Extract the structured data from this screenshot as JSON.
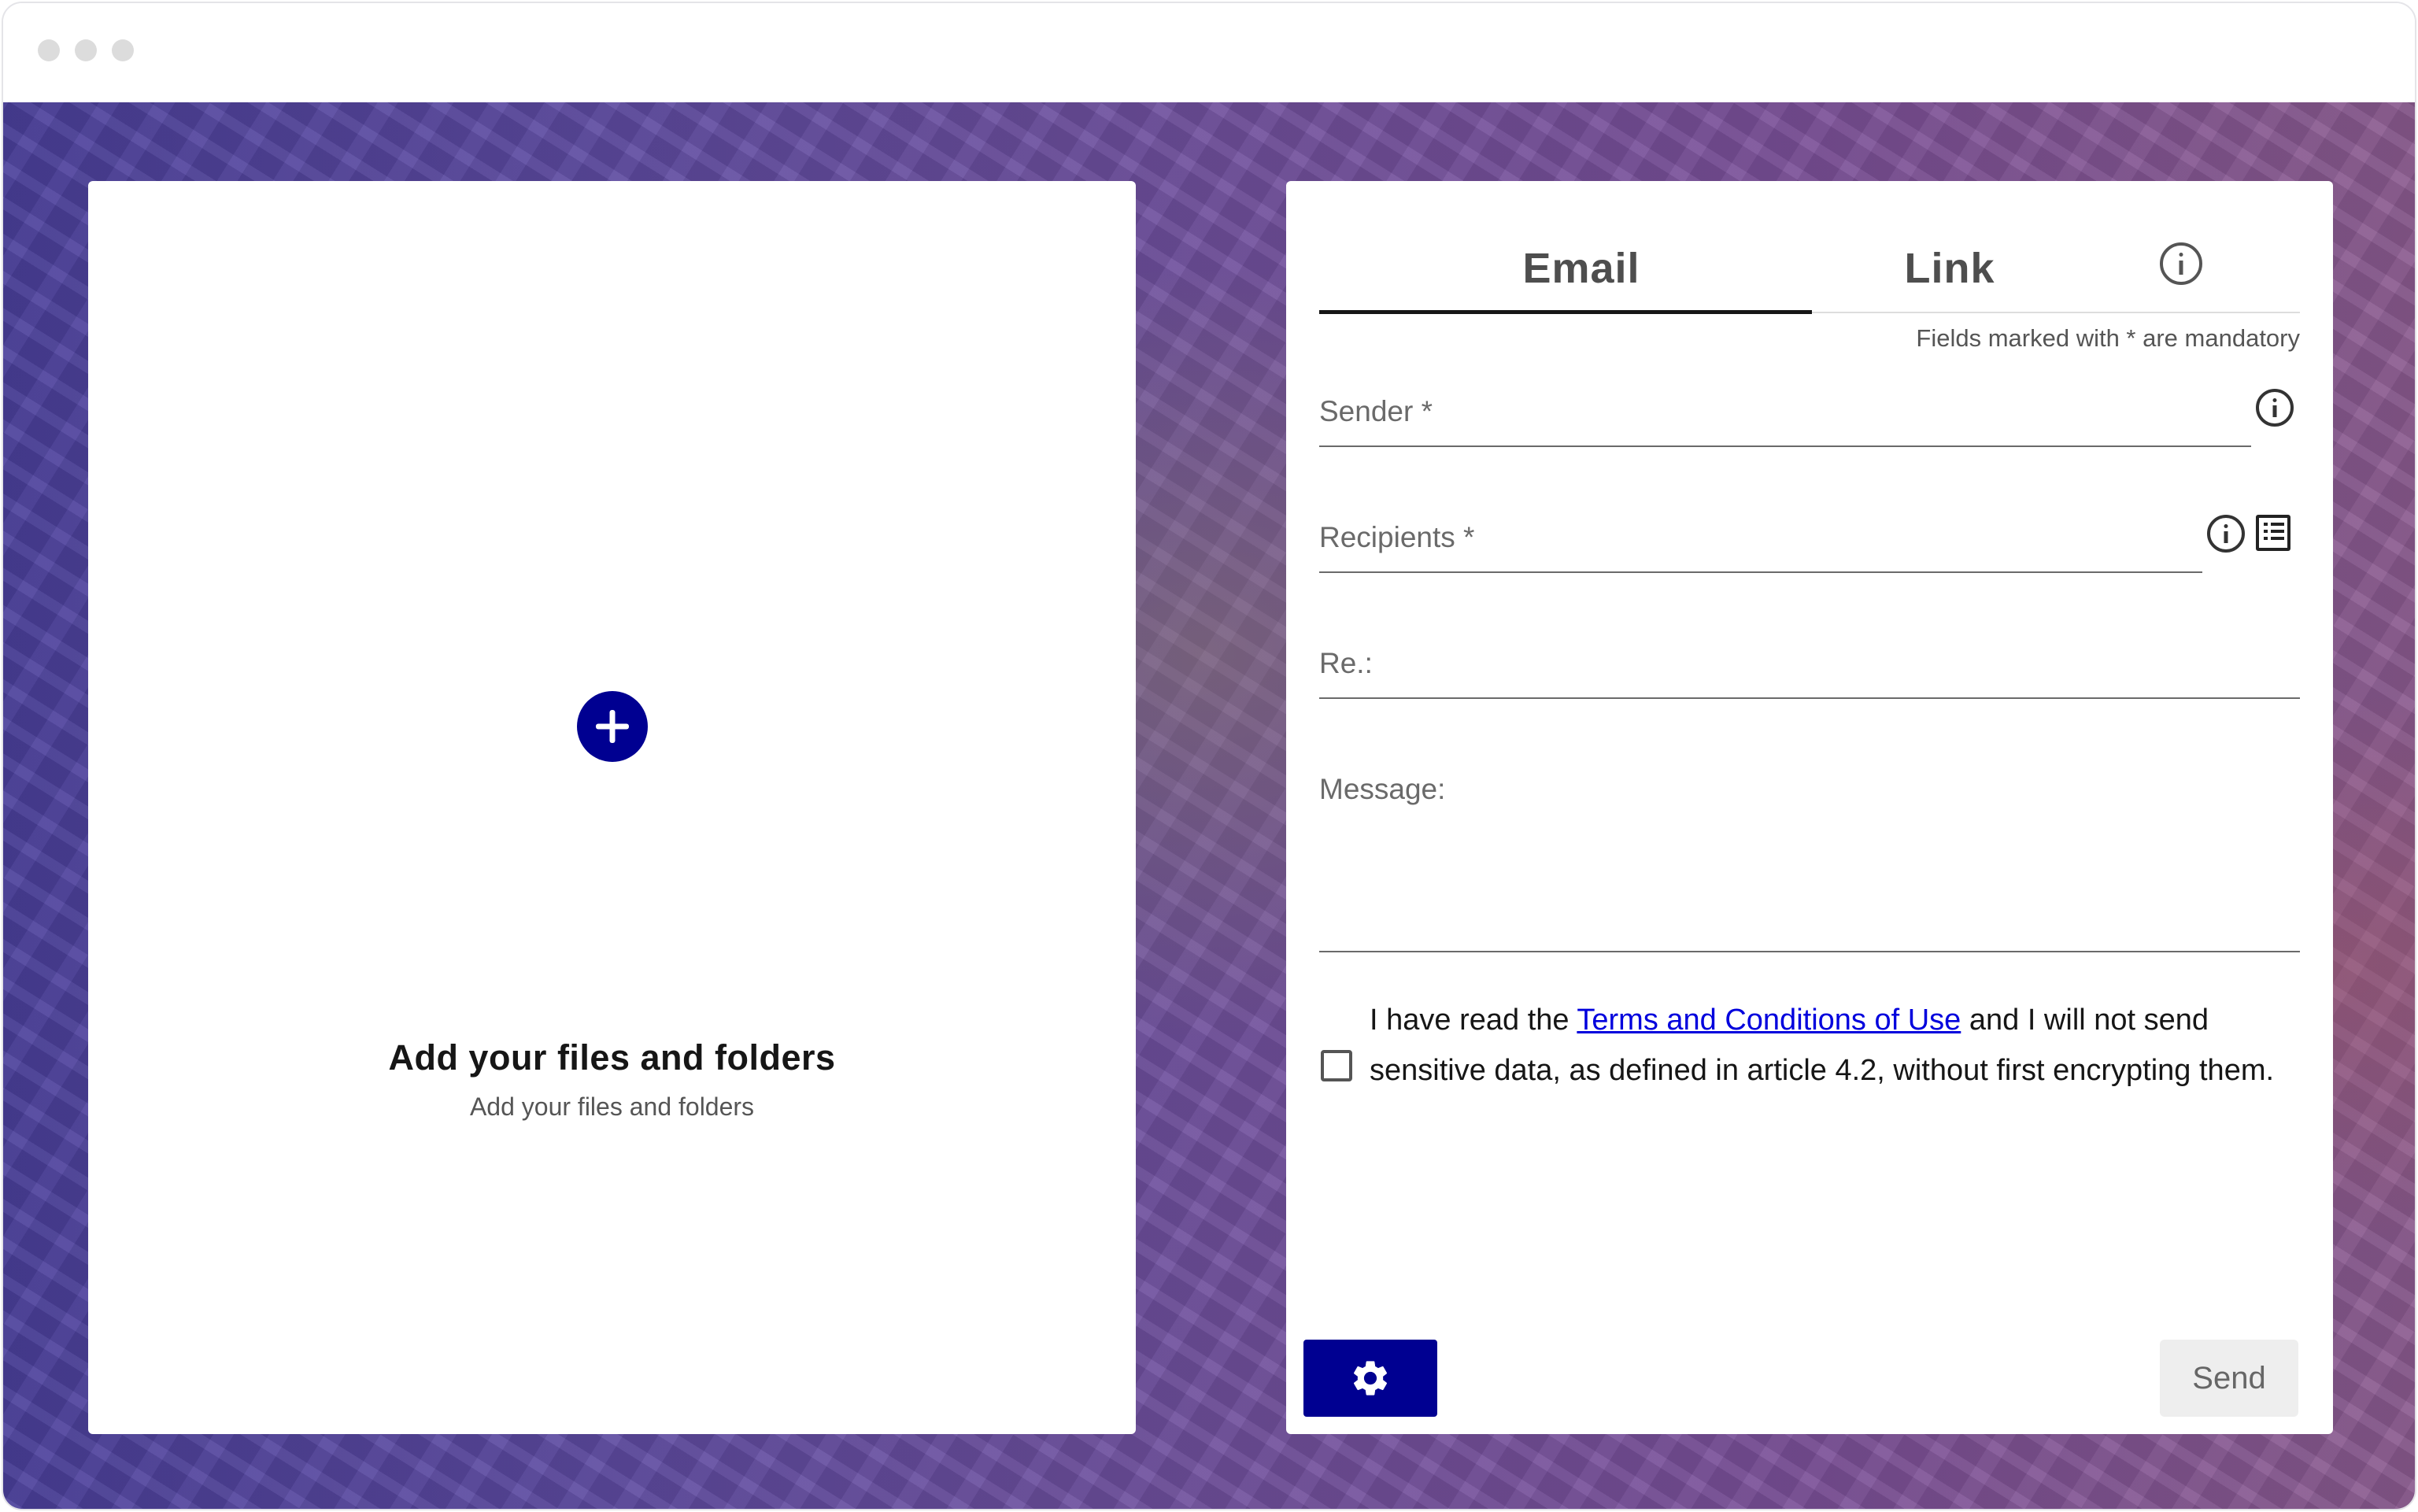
{
  "upload": {
    "title": "Add your files and folders",
    "subtitle": "Add your files and folders"
  },
  "tabs": [
    {
      "label": "Email",
      "active": true
    },
    {
      "label": "Link",
      "active": false
    }
  ],
  "mandatory_note": "Fields marked with * are mandatory",
  "form": {
    "sender_label": "Sender *",
    "recipients_label": "Recipients *",
    "subject_label": "Re.:",
    "message_label": "Message:"
  },
  "terms": {
    "before": "I have read the ",
    "link": "Terms and Conditions of Use",
    "after": " and I will not send sensitive data, as defined in article 4.2, without first encrypting them.",
    "checked": false
  },
  "actions": {
    "send_label": "Send"
  },
  "colors": {
    "accent": "#000091",
    "link": "#0000dd"
  },
  "icons": [
    "plus-icon",
    "info-icon",
    "list-icon",
    "gear-icon"
  ]
}
